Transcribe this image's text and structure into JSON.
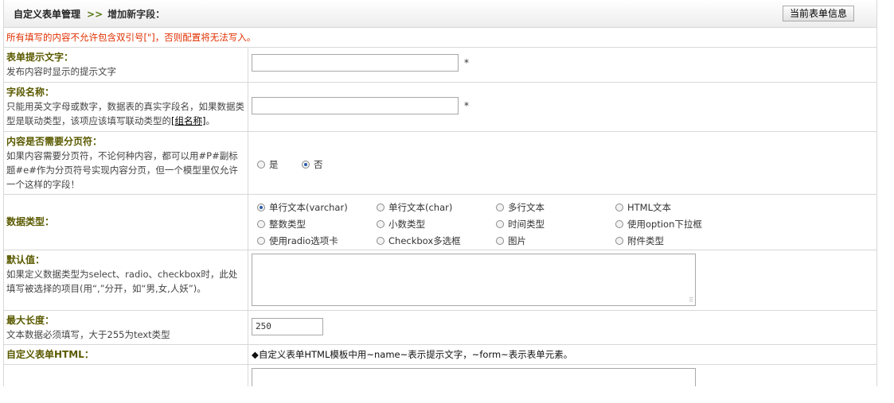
{
  "header": {
    "crumb_main": "自定义表单管理",
    "crumb_sep": ">>",
    "crumb_current": "增加新字段：",
    "button_label": "当前表单信息"
  },
  "notice": "所有填写的内容不允许包含双引号[\"]，否则配置将无法写入。",
  "fields": {
    "itemname": {
      "title": "表单提示文字：",
      "desc": "发布内容时显示的提示文字",
      "value": "",
      "required_mark": "*"
    },
    "fieldname": {
      "title": "字段名称：",
      "desc_pre": "只能用英文字母或数字，数据表的真实字段名，如果数据类型是联动类型，该项应该填写联动类型的",
      "desc_link": "[组名称]",
      "desc_post": "。",
      "value": "",
      "required_mark": "*"
    },
    "pagebreak": {
      "title": "内容是否需要分页符：",
      "desc": "如果内容需要分页符，不论何种内容，都可以用#P#副标题#e#作为分页符号实现内容分页，但一个模型里仅允许一个这样的字段！",
      "options": [
        "是",
        "否"
      ],
      "selected": "否"
    },
    "datatype": {
      "title": "数据类型：",
      "options": [
        "单行文本(varchar)",
        "单行文本(char)",
        "多行文本",
        "HTML文本",
        "整数类型",
        "小数类型",
        "时间类型",
        "使用option下拉框",
        "使用radio选项卡",
        "Checkbox多选框",
        "图片",
        "附件类型"
      ],
      "selected": "单行文本(varchar)"
    },
    "default": {
      "title": "默认值：",
      "desc": "如果定义数据类型为select、radio、checkbox时，此处填写被选择的项目(用“,”分开，如“男,女,人妖”)。",
      "value": ""
    },
    "maxlength": {
      "title": "最大长度：",
      "desc": "文本数据必须填写，大于255为text类型",
      "value": "250"
    },
    "html": {
      "title": "自定义表单HTML：",
      "hint": "◆自定义表单HTML模板中用~name~表示提示文字，~form~表示表单元素。"
    }
  }
}
